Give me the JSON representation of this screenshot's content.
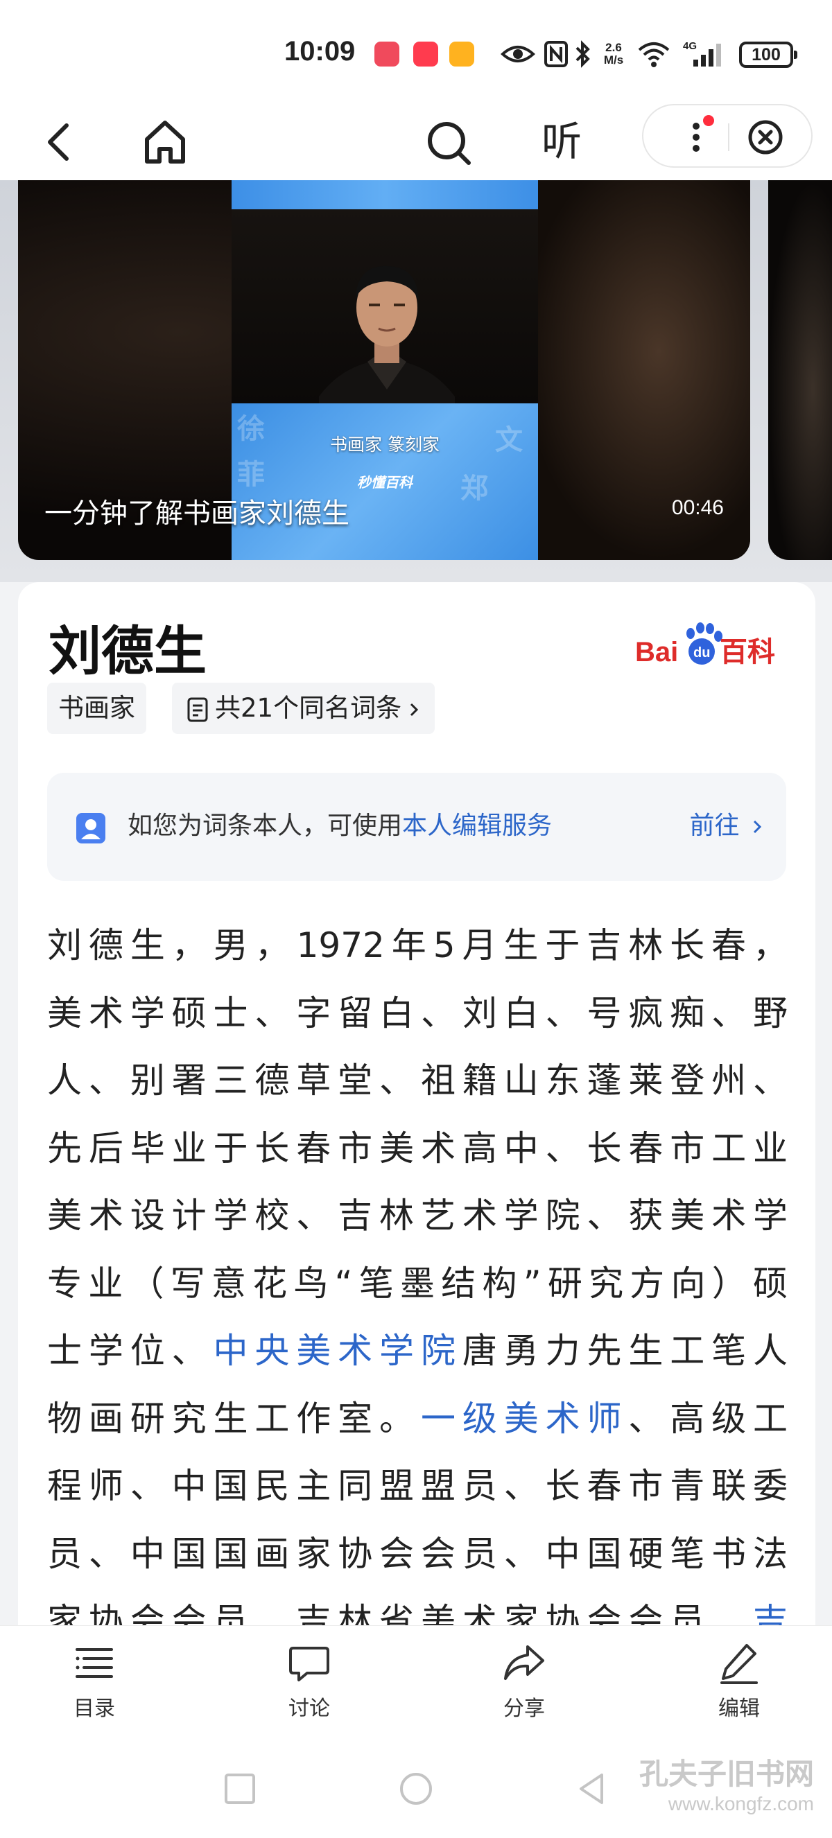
{
  "status_bar": {
    "time": "10:09",
    "net_speed_top": "2.6",
    "net_speed_bottom": "M/s",
    "signal_label": "4G",
    "battery": "100",
    "icons": [
      "app-notification-icon",
      "app-notification-icon",
      "app-notification-icon",
      "eye-icon",
      "nfc-icon",
      "bluetooth-icon",
      "wifi-icon",
      "cellular-signal-icon",
      "battery-icon"
    ]
  },
  "nav": {
    "back_icon": "back-arrow-icon",
    "home_icon": "home-icon",
    "search_icon": "search-icon",
    "listen_label": "听",
    "more_icon": "more-vertical-icon",
    "close_icon": "close-circle-icon"
  },
  "video": {
    "title": "一分钟了解书画家刘德生",
    "duration": "00:46",
    "poster_subtitle": "书画家  篆刻家",
    "poster_brand": "秒懂百科"
  },
  "entry": {
    "title": "刘德生",
    "logo_text": "Bai百科",
    "tag_profession": "书画家",
    "tag_same_name": "共21个同名词条",
    "notice": {
      "prefix": "如您为词条本人，可使用",
      "link": "本人编辑服务",
      "action": "前往"
    },
    "body_lines": [
      [
        "刘德生，男，1972年5月生于吉林长春，"
      ],
      [
        "美术学硕士、字留白、刘白、号疯痴、野"
      ],
      [
        "人、别署三德草堂、祖籍山东蓬莱登州、"
      ],
      [
        "先后毕业于长春市美术高中、长春市工业"
      ],
      [
        "美术设计学校、吉林艺术学院、获美术学"
      ],
      [
        "专业（写意花鸟“笔墨结构”研究方向）硕"
      ]
    ],
    "body_line7_a": "士学位、",
    "body_line7_link": "中央美术学院",
    "body_line7_b": "唐勇力先生工笔人",
    "body_line8_a": "物画研究生工作室。",
    "body_line8_link": "一级美术师",
    "body_line8_b": "、高级工",
    "body_line9": "程师、中国民主同盟盟员、长春市青联委",
    "body_line10": "员、中国国画家协会会员、中国硬笔书法",
    "body_line11_a": "家协会会员、吉林省美术家协会会员、",
    "body_line11_link": "吉"
  },
  "toolbar": {
    "contents": "目录",
    "discuss": "讨论",
    "share": "分享",
    "edit": "编辑"
  },
  "watermark": {
    "line1": "孔夫子旧书网",
    "line2": "www.kongfz.com"
  }
}
